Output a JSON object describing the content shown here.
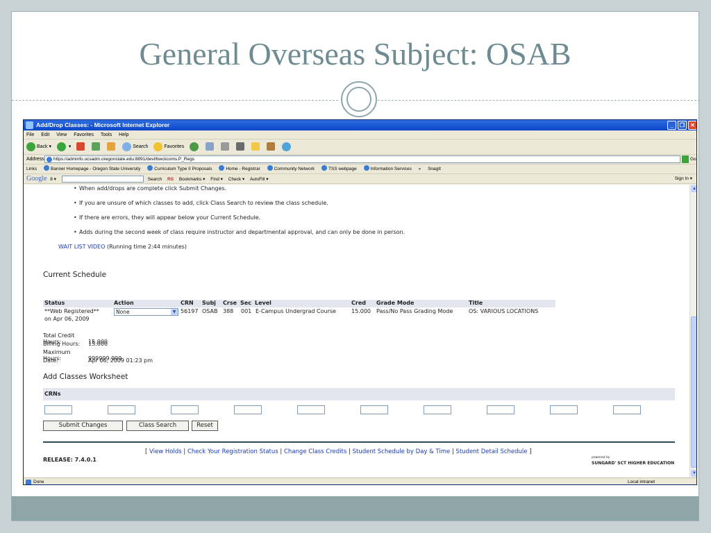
{
  "slide": {
    "title": "General Overseas Subject: OSAB"
  },
  "window": {
    "title": "Add/Drop Classes: - Microsoft Internet Explorer",
    "min_label": "_",
    "max_label": "❐",
    "close_label": "✕"
  },
  "menu": [
    "File",
    "Edit",
    "View",
    "Favorites",
    "Tools",
    "Help"
  ],
  "toolbar": {
    "back": "Back",
    "search": "Search",
    "favorites": "Favorites"
  },
  "address": {
    "label": "Address",
    "url": "https://adminfo.ucsadm.oregonstate.edu:8891/devl/bwckcoms.P_Regs",
    "go": "Go"
  },
  "links_bar": {
    "label": "Links",
    "items": [
      "Banner Homepage - Oregon State University",
      "Curriculum Type II Proposals",
      "Home - Registrar",
      "Community Network",
      "TSS webpage",
      "Information Services"
    ],
    "chevron": "»",
    "snagit": "SnagIt"
  },
  "google_bar": {
    "logo": "Google",
    "g8": "8 ▾",
    "search": "Search",
    "rs": "RS",
    "bookmarks": "Bookmarks ▾",
    "find": "Find ▾",
    "check": "Check ▾",
    "autofill": "AutoFill ▾",
    "sign_in": "Sign In ▾"
  },
  "instructions": [
    "When add/drops are complete click Submit Changes.",
    "If you are unsure of which classes to add, click Class Search to review the class schedule.",
    "If there are errors, they will appear below your Current Schedule.",
    "Adds during the second week of class require instructor and departmental approval, and can only be done in person."
  ],
  "wait_list": {
    "link": "WAIT LIST VIDEO",
    "note": "(Running time 2:44 minutes)"
  },
  "current_schedule": {
    "heading": "Current Schedule",
    "columns": [
      "Status",
      "Action",
      "CRN",
      "Subj",
      "Crse",
      "Sec",
      "Level",
      "Cred",
      "Grade Mode",
      "Title"
    ],
    "row": {
      "status_line1": "**Web Registered**",
      "status_line2": "on Apr 06, 2009",
      "action": "None",
      "crn": "56197",
      "subj": "OSAB",
      "crse": "388",
      "sec": "001",
      "level": "E-Campus Undergrad Course",
      "cred": "15.000",
      "grade_mode": "Pass/No Pass Grading Mode",
      "title": "OS: VARIOUS LOCATIONS"
    }
  },
  "totals": [
    {
      "label": "Total Credit Hours:",
      "value": "15.000"
    },
    {
      "label": "Billing Hours:",
      "value": "15.000"
    },
    {
      "label": "Maximum Hours:",
      "value": "999999.999"
    },
    {
      "label": "Date:",
      "value": "Apr 06, 2009 01:23 pm"
    }
  ],
  "worksheet": {
    "heading": "Add Classes Worksheet",
    "crns_label": "CRNs",
    "crn_values": [
      "",
      "",
      "",
      "",
      "",
      "",
      "",
      "",
      "",
      ""
    ]
  },
  "buttons": {
    "submit": "Submit Changes",
    "class_search": "Class Search",
    "reset": "Reset"
  },
  "footer": {
    "release": "RELEASE: 7.4.0.1",
    "open_bracket": "[",
    "close_bracket": "]",
    "links": [
      "View Holds",
      "Check Your Registration Status",
      "Change Class Credits",
      "Student Schedule by Day & Time",
      "Student Detail Schedule"
    ],
    "powered_by": "powered by",
    "vendor": "SUNGARD' SCT HIGHER EDUCATION"
  },
  "status_bar": {
    "text": "Done",
    "zone": "Local intranet"
  }
}
